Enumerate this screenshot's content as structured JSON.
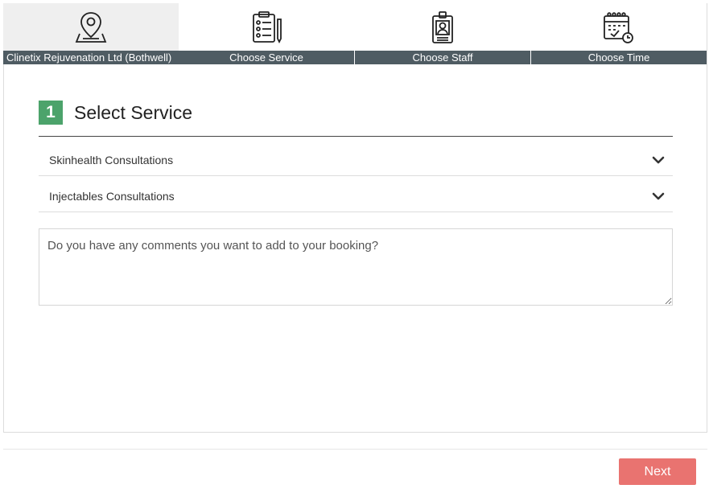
{
  "steps": [
    {
      "label": "Clinetix Rejuvenation Ltd (Bothwell)",
      "icon": "location-pin-icon",
      "active": true
    },
    {
      "label": "Choose Service",
      "icon": "clipboard-checklist-icon",
      "active": false
    },
    {
      "label": "Choose Staff",
      "icon": "staff-badge-icon",
      "active": false
    },
    {
      "label": "Choose Time",
      "icon": "calendar-clock-icon",
      "active": false
    }
  ],
  "section": {
    "number": "1",
    "title": "Select Service"
  },
  "services": [
    {
      "label": "Skinhealth Consultations"
    },
    {
      "label": "Injectables Consultations"
    }
  ],
  "comments": {
    "placeholder": "Do you have any comments you want to add to your booking?",
    "value": ""
  },
  "actions": {
    "next_label": "Next"
  },
  "colors": {
    "accent_green": "#4ca36b",
    "step_bar": "#4f5c63",
    "next_button": "#e97370",
    "active_step_bg": "#efefef"
  }
}
